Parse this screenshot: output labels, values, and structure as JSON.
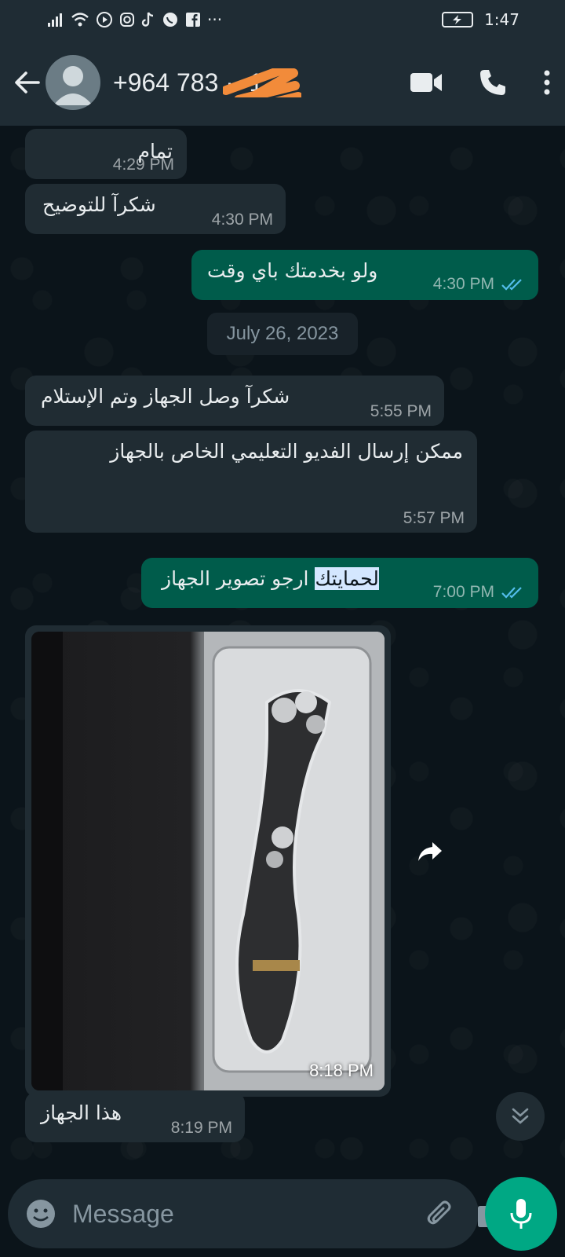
{
  "status_bar": {
    "time": "1:47",
    "icons": [
      "signal-icon",
      "wifi-icon",
      "play-circle-icon",
      "instagram-icon",
      "tiktok-icon",
      "whatsapp-icon",
      "facebook-icon",
      "more-notifications-icon",
      "battery-charging-icon"
    ],
    "more": "···"
  },
  "header": {
    "contact": "+964 783 ·· 1...",
    "colors": {
      "bar": "#1f2c34",
      "scribble": "#f28b3a"
    }
  },
  "chat": {
    "date_divider": "July 26, 2023",
    "messages": [
      {
        "dir": "in",
        "text": "تمام",
        "time": "4:29 PM"
      },
      {
        "dir": "in",
        "text": "شكرآ للتوضيح",
        "time": "4:30 PM"
      },
      {
        "dir": "out",
        "text": "ولو بخدمتك باي وقت",
        "time": "4:30 PM",
        "status": "read"
      },
      {
        "dir": "in",
        "text": "شكرآ وصل  الجهاز وتم الإستلام",
        "time": "5:55 PM"
      },
      {
        "dir": "in",
        "text": "ممكن إرسال الفديو  التعليمي الخاص بالجهاز",
        "time": "5:57 PM"
      },
      {
        "dir": "out",
        "text_highlight": "لحمايتك",
        "text_rest": " ارجو تصوير الجهاز",
        "time": "7:00 PM",
        "status": "read"
      },
      {
        "dir": "in",
        "type": "image",
        "time": "8:18 PM"
      },
      {
        "dir": "in",
        "text": "هذا الجهاز",
        "time": "8:19 PM"
      }
    ],
    "colors": {
      "incoming": "#202c33",
      "outgoing": "#005c4b",
      "read_ticks": "#53bdeb"
    }
  },
  "composer": {
    "placeholder": "Message",
    "accent": "#00a884"
  }
}
